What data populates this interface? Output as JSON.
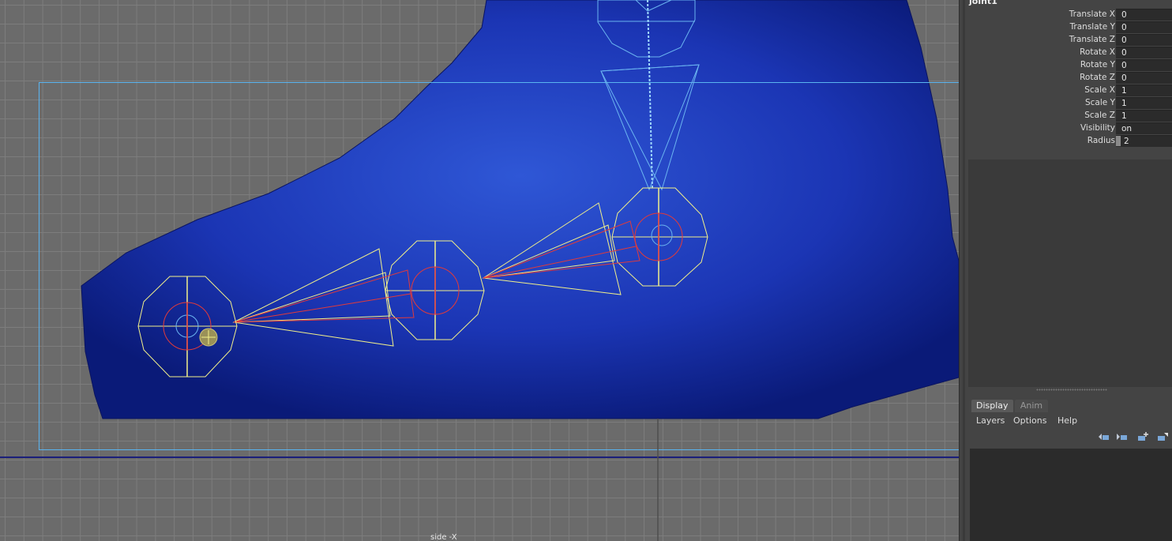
{
  "viewport": {
    "camera_label": "side -X"
  },
  "channel_box": {
    "node_name": "joint1",
    "attributes": [
      {
        "label": "Translate X",
        "value": "0"
      },
      {
        "label": "Translate Y",
        "value": "0"
      },
      {
        "label": "Translate Z",
        "value": "0"
      },
      {
        "label": "Rotate X",
        "value": "0"
      },
      {
        "label": "Rotate Y",
        "value": "0"
      },
      {
        "label": "Rotate Z",
        "value": "0"
      },
      {
        "label": "Scale X",
        "value": "1"
      },
      {
        "label": "Scale Y",
        "value": "1"
      },
      {
        "label": "Scale Z",
        "value": "1"
      },
      {
        "label": "Visibility",
        "value": "on"
      },
      {
        "label": "Radius",
        "value": "2"
      }
    ]
  },
  "layer_editor": {
    "tabs": [
      {
        "label": "Display",
        "active": true
      },
      {
        "label": "Anim",
        "active": false
      }
    ],
    "menu": [
      "Layers",
      "Options",
      "Help"
    ],
    "tool_icons": [
      "move-layer-up-icon",
      "move-layer-down-icon",
      "new-layer-icon",
      "new-layer-selected-icon"
    ]
  },
  "colors": {
    "mesh_blue": "#1a33b0",
    "joint_yellow": "#f2f08a",
    "joint_red": "#e23a3a",
    "selection_cyan": "#4aa8e8",
    "grid_background": "#6b6b6b"
  }
}
